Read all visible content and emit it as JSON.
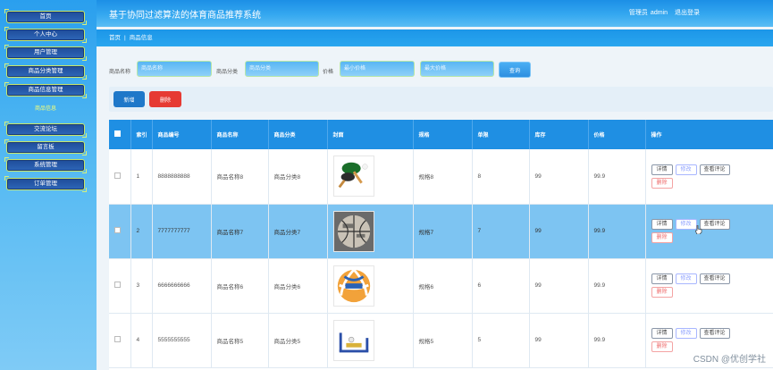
{
  "app": {
    "title": "基于协同过滤算法的体育商品推荐系统"
  },
  "user": {
    "role": "管理员",
    "name": "admin",
    "logout": "退出登录"
  },
  "sidebar": {
    "items": [
      {
        "label": "首页"
      },
      {
        "label": "个人中心"
      },
      {
        "label": "用户管理"
      },
      {
        "label": "商品分类管理"
      },
      {
        "label": "商品信息管理"
      },
      {
        "label": "交流论坛"
      },
      {
        "label": "留言板"
      },
      {
        "label": "系统管理"
      },
      {
        "label": "订单管理"
      }
    ],
    "active_sub": "商品信息"
  },
  "breadcrumb": {
    "home": "首页",
    "current": "商品信息"
  },
  "search": {
    "name_label": "商品名称",
    "name_placeholder": "商品名称",
    "category_label": "商品分类",
    "category_placeholder": "商品分类",
    "price_label": "价格",
    "price_min_placeholder": "最小价格",
    "price_max_placeholder": "最大价格",
    "query_button": "查询"
  },
  "toolbar": {
    "add": "新增",
    "delete": "删除"
  },
  "table": {
    "headers": [
      "索引",
      "商品编号",
      "商品名称",
      "商品分类",
      "封面",
      "规格",
      "单限",
      "库存",
      "价格",
      "操作"
    ],
    "rows": [
      {
        "index": "1",
        "code": "8888888888",
        "name": "商品名称8",
        "category": "商品分类8",
        "cover": "table-tennis-paddle",
        "spec": "规格8",
        "limit": "8",
        "stock": "99",
        "price": "99.9"
      },
      {
        "index": "2",
        "code": "7777777777",
        "name": "商品名称7",
        "category": "商品分类7",
        "cover": "basketball",
        "spec": "规格7",
        "limit": "7",
        "stock": "99",
        "price": "99.9"
      },
      {
        "index": "3",
        "code": "6666666666",
        "name": "商品名称6",
        "category": "商品分类6",
        "cover": "volleyball",
        "spec": "规格6",
        "limit": "6",
        "stock": "99",
        "price": "99.9"
      },
      {
        "index": "4",
        "code": "5555555555",
        "name": "商品名称5",
        "category": "商品分类5",
        "cover": "fitness-equipment",
        "spec": "规格5",
        "limit": "5",
        "stock": "99",
        "price": "99.9"
      }
    ],
    "ops": {
      "detail": "详情",
      "edit": "修改",
      "review": "查看评论",
      "delete": "删除"
    }
  },
  "watermark": "CSDN @优创学社",
  "colors": {
    "header": "#1f8fe3",
    "highlight_row": "#7dc4f2",
    "danger": "#e63a33",
    "primary": "#1f78c9"
  }
}
